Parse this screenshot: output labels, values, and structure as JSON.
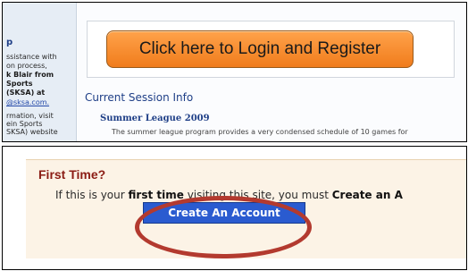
{
  "sidebar": {
    "lines": [
      {
        "text": "p",
        "style": "heading"
      },
      {
        "text": "ssistance with",
        "style": "normal"
      },
      {
        "text": "on process,",
        "style": "normal"
      },
      {
        "text": "k Blair from",
        "style": "bold"
      },
      {
        "text": "Sports",
        "style": "bold"
      },
      {
        "text": "(SKSA) at",
        "style": "bold"
      },
      {
        "text": "@sksa.com.",
        "style": "link"
      },
      {
        "text": "rmation, visit",
        "style": "normal"
      },
      {
        "text": "ein Sports",
        "style": "normal"
      },
      {
        "text": "SKSA) website",
        "style": "normal"
      }
    ]
  },
  "login": {
    "button_label": "Click here to Login and Register"
  },
  "session": {
    "heading": "Current Session Info",
    "league_title": "Summer League 2009",
    "league_desc": "The summer league program provides a very condensed schedule of 10 games for"
  },
  "first_time": {
    "title": "First Time?",
    "text_prefix": "If this is your ",
    "text_bold1": "first time",
    "text_middle": " visiting this site, you must ",
    "text_bold2": "Create an A",
    "button_label": "Create An Account"
  },
  "colors": {
    "login_button": "#f58a2a",
    "create_button": "#2a5bd0",
    "title_red": "#8b1c14",
    "highlight": "#b33a2f"
  }
}
